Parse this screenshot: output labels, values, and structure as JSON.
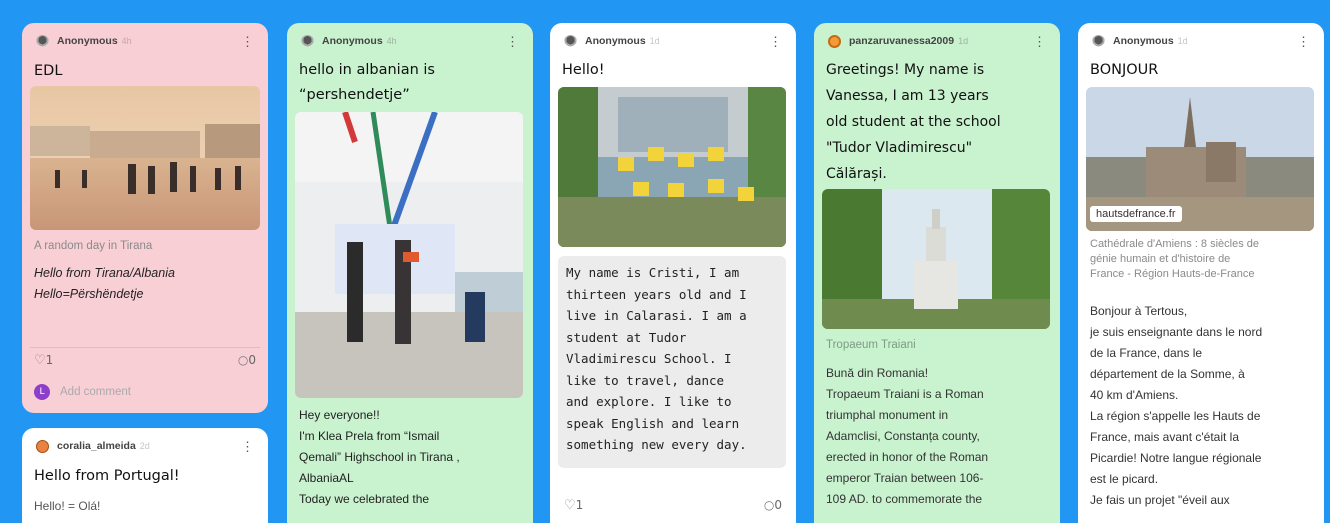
{
  "cards": [
    {
      "author": "Anonymous",
      "time": "4h",
      "title": "EDL",
      "caption": "A random day in Tirana",
      "body_lines": [
        "Hello from Tirana/Albania",
        "Hello=Përshëndetje"
      ],
      "likes": "1",
      "comments": "0",
      "add_comment": "Add comment",
      "avatar_letter": "L"
    },
    {
      "author": "coralia_almeida",
      "time": "2d",
      "title": "Hello from Portugal!",
      "body": "Hello! = Olá!"
    },
    {
      "author": "Anonymous",
      "time": "4h",
      "title_lines": [
        "hello in albanian is",
        "“pershendetje”"
      ],
      "body_lines": [
        "Hey everyone!!",
        "I'm Klea Prela from “Ismail",
        "Qemali” Highschool in Tirana ,",
        "AlbaniaAL",
        "Today we celebrated the"
      ]
    },
    {
      "author": "Anonymous",
      "time": "1d",
      "title": "Hello!",
      "body_lines": [
        "My name is Cristi, I am",
        "thirteen years old and I",
        "live in Calarasi. I am a",
        "student at Tudor",
        "Vladimirescu School. I",
        "like to travel, dance",
        "and explore. I like to",
        "speak English and learn",
        "something new every day."
      ],
      "likes": "1",
      "comments": "0"
    },
    {
      "author": "panzaruvanessa2009",
      "time": "1d",
      "title_lines": [
        "Greetings! My name is",
        "Vanessa, I am 13 years",
        "old student at the school",
        "\"Tudor Vladimirescu\"",
        "Călărași."
      ],
      "caption": "Tropaeum Traiani",
      "body_lines": [
        "Bună din Romania!",
        "Tropaeum Traiani is a Roman",
        "triumphal monument in",
        "Adamclisi, Constanța county,",
        "erected in honor of the Roman",
        "emperor Traian between 106-",
        "109 AD.  to commemorate the"
      ]
    },
    {
      "author": "Anonymous",
      "time": "1d",
      "title": "BONJOUR",
      "link_label": "hautsdefrance.fr",
      "caption_lines": [
        "Cathédrale d'Amiens : 8 siècles de",
        "génie humain et d'histoire de",
        "France - Région Hauts-de-France"
      ],
      "body_lines": [
        "Bonjour à Tertous,",
        "je suis enseignante dans le nord",
        "de la France, dans le",
        "département de la Somme, à",
        "40 km d'Amiens.",
        "La région s'appelle les Hauts de",
        "France, mais avant c'était la",
        "Picardie! Notre langue régionale",
        "est le picard.",
        "Je fais un projet \"éveil aux"
      ]
    }
  ],
  "icons": {
    "menu": "more-vertical-icon",
    "like": "heart-icon",
    "comment": "comment-bubble-icon"
  },
  "colors": {
    "background": "#2196f3",
    "pink_card": "#f9cfd6",
    "green_card": "#c9f2cf",
    "white_card": "#ffffff"
  }
}
